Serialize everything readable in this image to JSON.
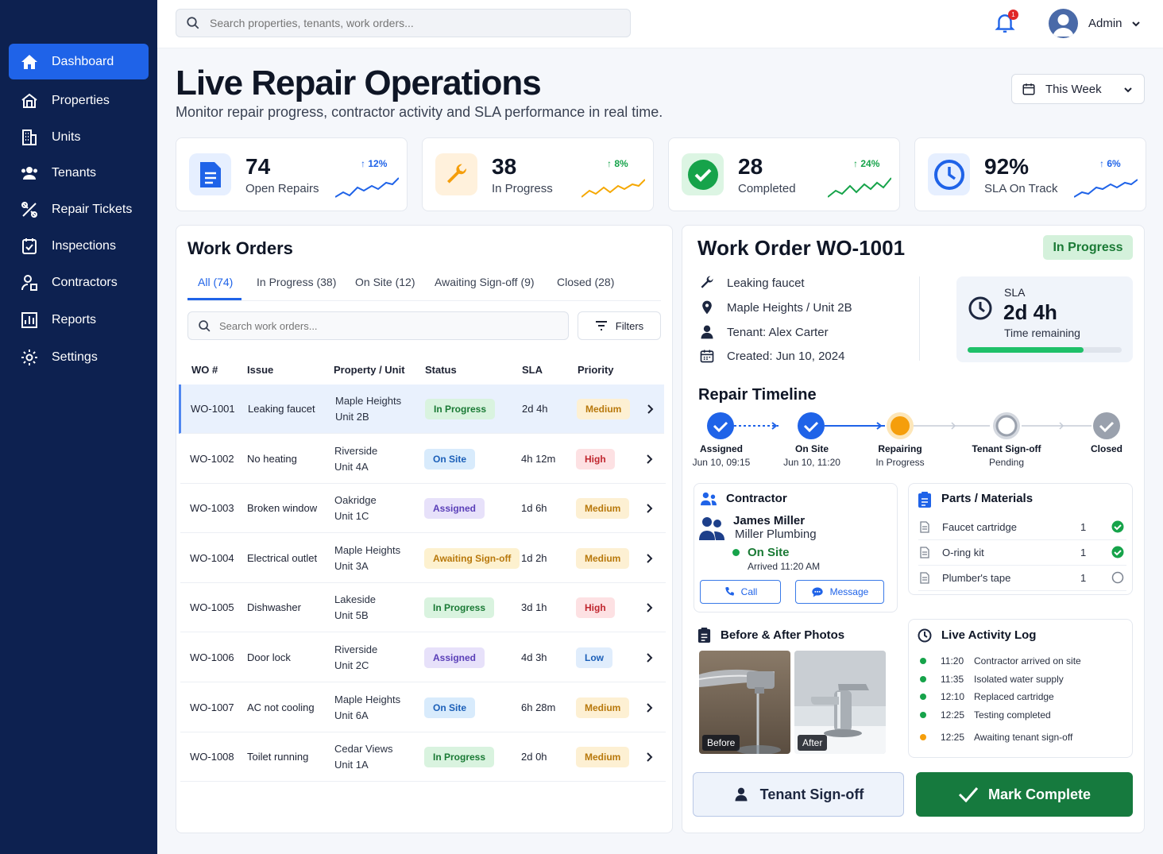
{
  "nav": {
    "items": [
      {
        "label": "Dashboard",
        "icon": "home-icon"
      },
      {
        "label": "Properties",
        "icon": "building-icon"
      },
      {
        "label": "Units",
        "icon": "units-icon"
      },
      {
        "label": "Tenants",
        "icon": "people-icon"
      },
      {
        "label": "Repair Tickets",
        "icon": "tools-icon"
      },
      {
        "label": "Inspections",
        "icon": "clipboard-check-icon"
      },
      {
        "label": "Contractors",
        "icon": "contractor-icon"
      },
      {
        "label": "Reports",
        "icon": "chart-icon"
      },
      {
        "label": "Settings",
        "icon": "gear-icon"
      }
    ]
  },
  "topbar": {
    "search_placeholder": "Search properties, tenants, work orders...",
    "notification_count": "1",
    "user": "Admin"
  },
  "header": {
    "title": "Live Repair Operations",
    "subtitle": "Monitor repair progress, contractor activity and SLA performance in real time.",
    "range": "This Week"
  },
  "kpis": [
    {
      "value": "74",
      "label": "Open Repairs",
      "change": "12%",
      "color": "#1f63e8"
    },
    {
      "value": "38",
      "label": "In Progress",
      "change": "8%",
      "color": "#f59e0b"
    },
    {
      "value": "28",
      "label": "Completed",
      "change": "24%",
      "color": "#16a34a"
    },
    {
      "value": "92%",
      "label": "SLA On Track",
      "change": "6%",
      "color": "#1f63e8"
    }
  ],
  "work_orders": {
    "title": "Work Orders",
    "tabs": [
      "All (74)",
      "In Progress (38)",
      "On Site (12)",
      "Awaiting Sign-off (9)",
      "Closed (28)"
    ],
    "search_placeholder": "Search work orders...",
    "filters_label": "Filters",
    "columns": [
      "WO #",
      "Issue",
      "Property / Unit",
      "Status",
      "SLA",
      "Priority"
    ],
    "rows": [
      {
        "id": "WO-1001",
        "issue": "Leaking faucet",
        "property": "Maple Heights",
        "unit": "Unit 2B",
        "status": "In Progress",
        "sla": "2d 4h",
        "priority": "Medium"
      },
      {
        "id": "WO-1002",
        "issue": "No heating",
        "property": "Riverside",
        "unit": "Unit 4A",
        "status": "On Site",
        "sla": "4h 12m",
        "priority": "High"
      },
      {
        "id": "WO-1003",
        "issue": "Broken window",
        "property": "Oakridge",
        "unit": "Unit 1C",
        "status": "Assigned",
        "sla": "1d 6h",
        "priority": "Medium"
      },
      {
        "id": "WO-1004",
        "issue": "Electrical outlet",
        "property": "Maple Heights",
        "unit": "Unit 3A",
        "status": "Awaiting Sign-off",
        "sla": "1d 2h",
        "priority": "Medium"
      },
      {
        "id": "WO-1005",
        "issue": "Dishwasher",
        "property": "Lakeside",
        "unit": "Unit 5B",
        "status": "In Progress",
        "sla": "3d 1h",
        "priority": "High"
      },
      {
        "id": "WO-1006",
        "issue": "Door lock",
        "property": "Riverside",
        "unit": "Unit 2C",
        "status": "Assigned",
        "sla": "4d 3h",
        "priority": "Low"
      },
      {
        "id": "WO-1007",
        "issue": "AC not cooling",
        "property": "Maple Heights",
        "unit": "Unit 6A",
        "status": "On Site",
        "sla": "6h 28m",
        "priority": "Medium"
      },
      {
        "id": "WO-1008",
        "issue": "Toilet running",
        "property": "Cedar Views",
        "unit": "Unit 1A",
        "status": "In Progress",
        "sla": "2d 0h",
        "priority": "Medium"
      }
    ]
  },
  "detail": {
    "title": "Work Order WO-1001",
    "status": "In Progress",
    "issue": "Leaking faucet",
    "location": "Maple Heights / Unit 2B",
    "tenant": "Tenant: Alex Carter",
    "created": "Created: Jun 10, 2024",
    "sla": {
      "label": "SLA",
      "value": "2d 4h",
      "caption": "Time remaining",
      "progress": 0.75
    },
    "timeline_title": "Repair Timeline",
    "timeline": [
      {
        "title": "Assigned",
        "sub": "Jun 10, 09:15",
        "state": "done"
      },
      {
        "title": "On Site",
        "sub": "Jun 10, 11:20",
        "state": "done"
      },
      {
        "title": "Repairing",
        "sub": "In Progress",
        "state": "current"
      },
      {
        "title": "Tenant Sign-off",
        "sub": "Pending",
        "state": "pending"
      },
      {
        "title": "Closed",
        "sub": "",
        "state": "closed"
      }
    ],
    "contractor": {
      "title": "Contractor",
      "name": "James Miller",
      "company": "Miller Plumbing",
      "status": "On Site",
      "arrived": "Arrived 11:20 AM",
      "call_label": "Call",
      "message_label": "Message"
    },
    "parts": {
      "title": "Parts / Materials",
      "items": [
        {
          "name": "Faucet cartridge",
          "qty": "1",
          "done": true
        },
        {
          "name": "O-ring kit",
          "qty": "1",
          "done": true
        },
        {
          "name": "Plumber's tape",
          "qty": "1",
          "done": false
        }
      ]
    },
    "photos": {
      "title": "Before & After Photos",
      "before": "Before",
      "after": "After"
    },
    "activity": {
      "title": "Live Activity Log",
      "items": [
        {
          "time": "11:20",
          "text": "Contractor arrived on site",
          "color": "#16a34a"
        },
        {
          "time": "11:35",
          "text": "Isolated water supply",
          "color": "#16a34a"
        },
        {
          "time": "12:10",
          "text": "Replaced cartridge",
          "color": "#16a34a"
        },
        {
          "time": "12:25",
          "text": "Testing completed",
          "color": "#16a34a"
        },
        {
          "time": "12:25",
          "text": "Awaiting tenant sign-off",
          "color": "#f59e0b"
        }
      ]
    },
    "tenant_signoff_label": "Tenant Sign-off",
    "mark_complete_label": "Mark Complete"
  }
}
